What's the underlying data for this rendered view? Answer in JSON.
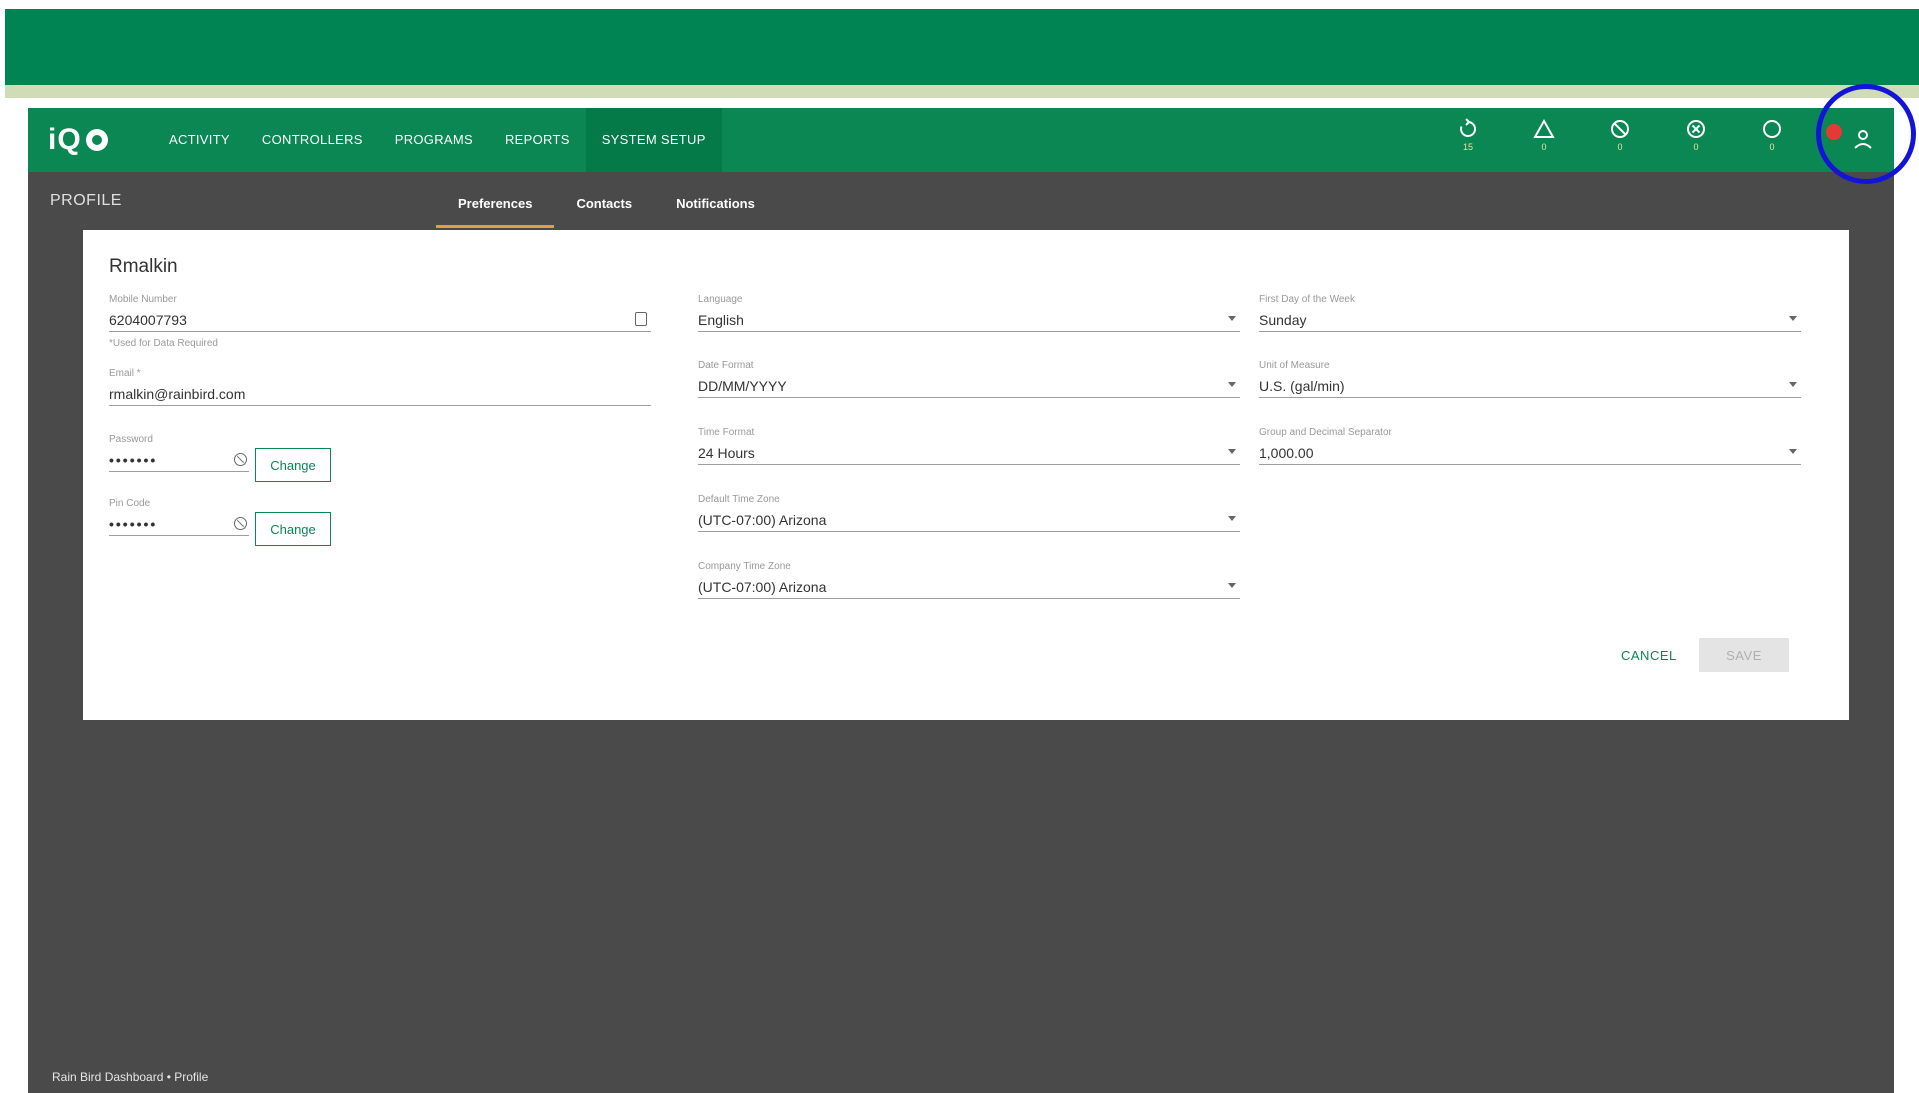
{
  "app": {
    "logo_text": "iQ",
    "menu": [
      "ACTIVITY",
      "CONTROLLERS",
      "PROGRAMS",
      "REPORTS",
      "SYSTEM SETUP"
    ],
    "status_counts": [
      "15",
      "0",
      "0",
      "0",
      "0"
    ],
    "status_icons": [
      "sync-icon",
      "warning-icon",
      "blocked-icon",
      "error-icon",
      "offline-icon"
    ]
  },
  "subheader": {
    "page_label": "PROFILE",
    "tabs": [
      "Preferences",
      "Contacts",
      "Notifications"
    ]
  },
  "profile": {
    "user_name": "Rmalkin",
    "mobile_label": "Mobile Number",
    "mobile_value": "6204007793",
    "mobile_hint": "*Used for Data Required",
    "email_label": "Email *",
    "email_value": "rmalkin@rainbird.com",
    "password_label": "Password",
    "password_value": "•••••••",
    "pincode_label": "Pin Code",
    "pincode_value": "•••••••",
    "change_label": "Change"
  },
  "preferences": {
    "language_label": "Language",
    "language_value": "English",
    "date_format_label": "Date Format",
    "date_format_value": "DD/MM/YYYY",
    "time_format_label": "Time Format",
    "time_format_value": "24 Hours",
    "default_tz_label": "Default Time Zone",
    "default_tz_value": "(UTC-07:00) Arizona",
    "company_tz_label": "Company Time Zone",
    "company_tz_value": "(UTC-07:00) Arizona",
    "first_day_label": "First Day of the Week",
    "first_day_value": "Sunday",
    "units_label": "Unit of Measure",
    "units_value": "U.S. (gal/min)",
    "separator_label": "Group and Decimal Separator",
    "separator_value": "1,000.00"
  },
  "actions": {
    "cancel": "CANCEL",
    "save": "SAVE"
  },
  "footer": {
    "text": "Rain Bird Dashboard • Profile"
  }
}
